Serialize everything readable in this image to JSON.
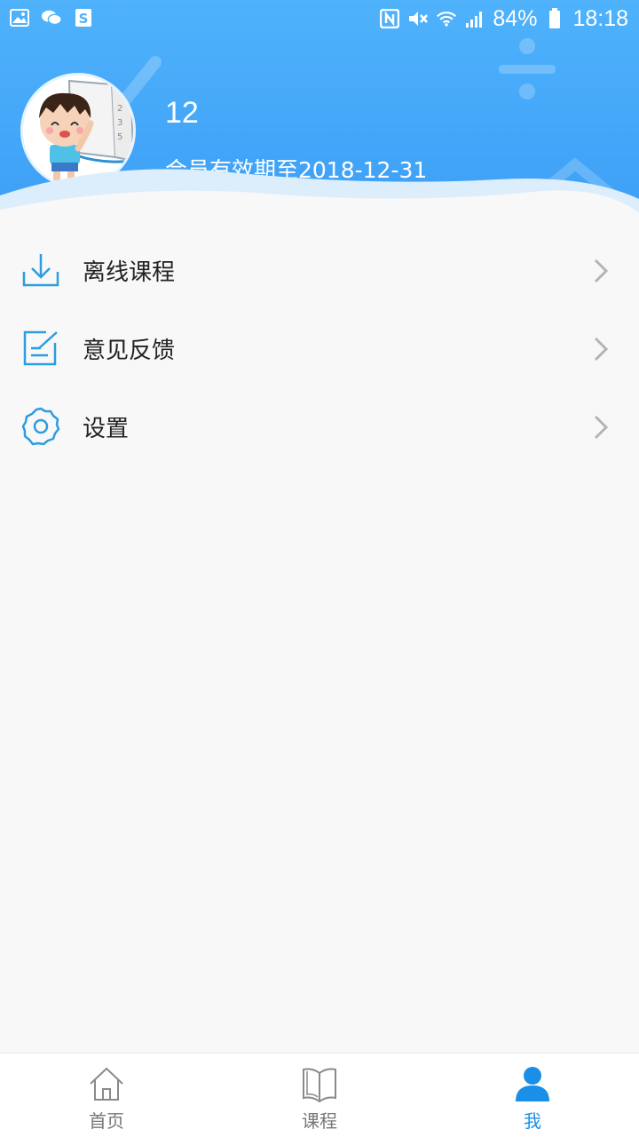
{
  "status_bar": {
    "battery": "84%",
    "time": "18:18",
    "icons_left": [
      "gallery-icon",
      "wechat-icon",
      "s-icon"
    ],
    "icons_right": [
      "nfc-icon",
      "mute-icon",
      "wifi-icon",
      "signal-icon",
      "battery-icon"
    ]
  },
  "profile": {
    "username": "12",
    "membership": "会员有效期至2018-12-31"
  },
  "menu": {
    "items": [
      {
        "label": "离线课程",
        "icon": "download-icon"
      },
      {
        "label": "意见反馈",
        "icon": "feedback-icon"
      },
      {
        "label": "设置",
        "icon": "settings-icon"
      }
    ]
  },
  "bottom_nav": {
    "items": [
      {
        "label": "首页",
        "icon": "home-icon",
        "active": false
      },
      {
        "label": "课程",
        "icon": "book-icon",
        "active": false
      },
      {
        "label": "我",
        "icon": "person-icon",
        "active": true
      }
    ]
  },
  "colors": {
    "accent": "#3d9ff6",
    "icon_blue": "#2b9de0",
    "active_nav": "#1a8fe8"
  }
}
